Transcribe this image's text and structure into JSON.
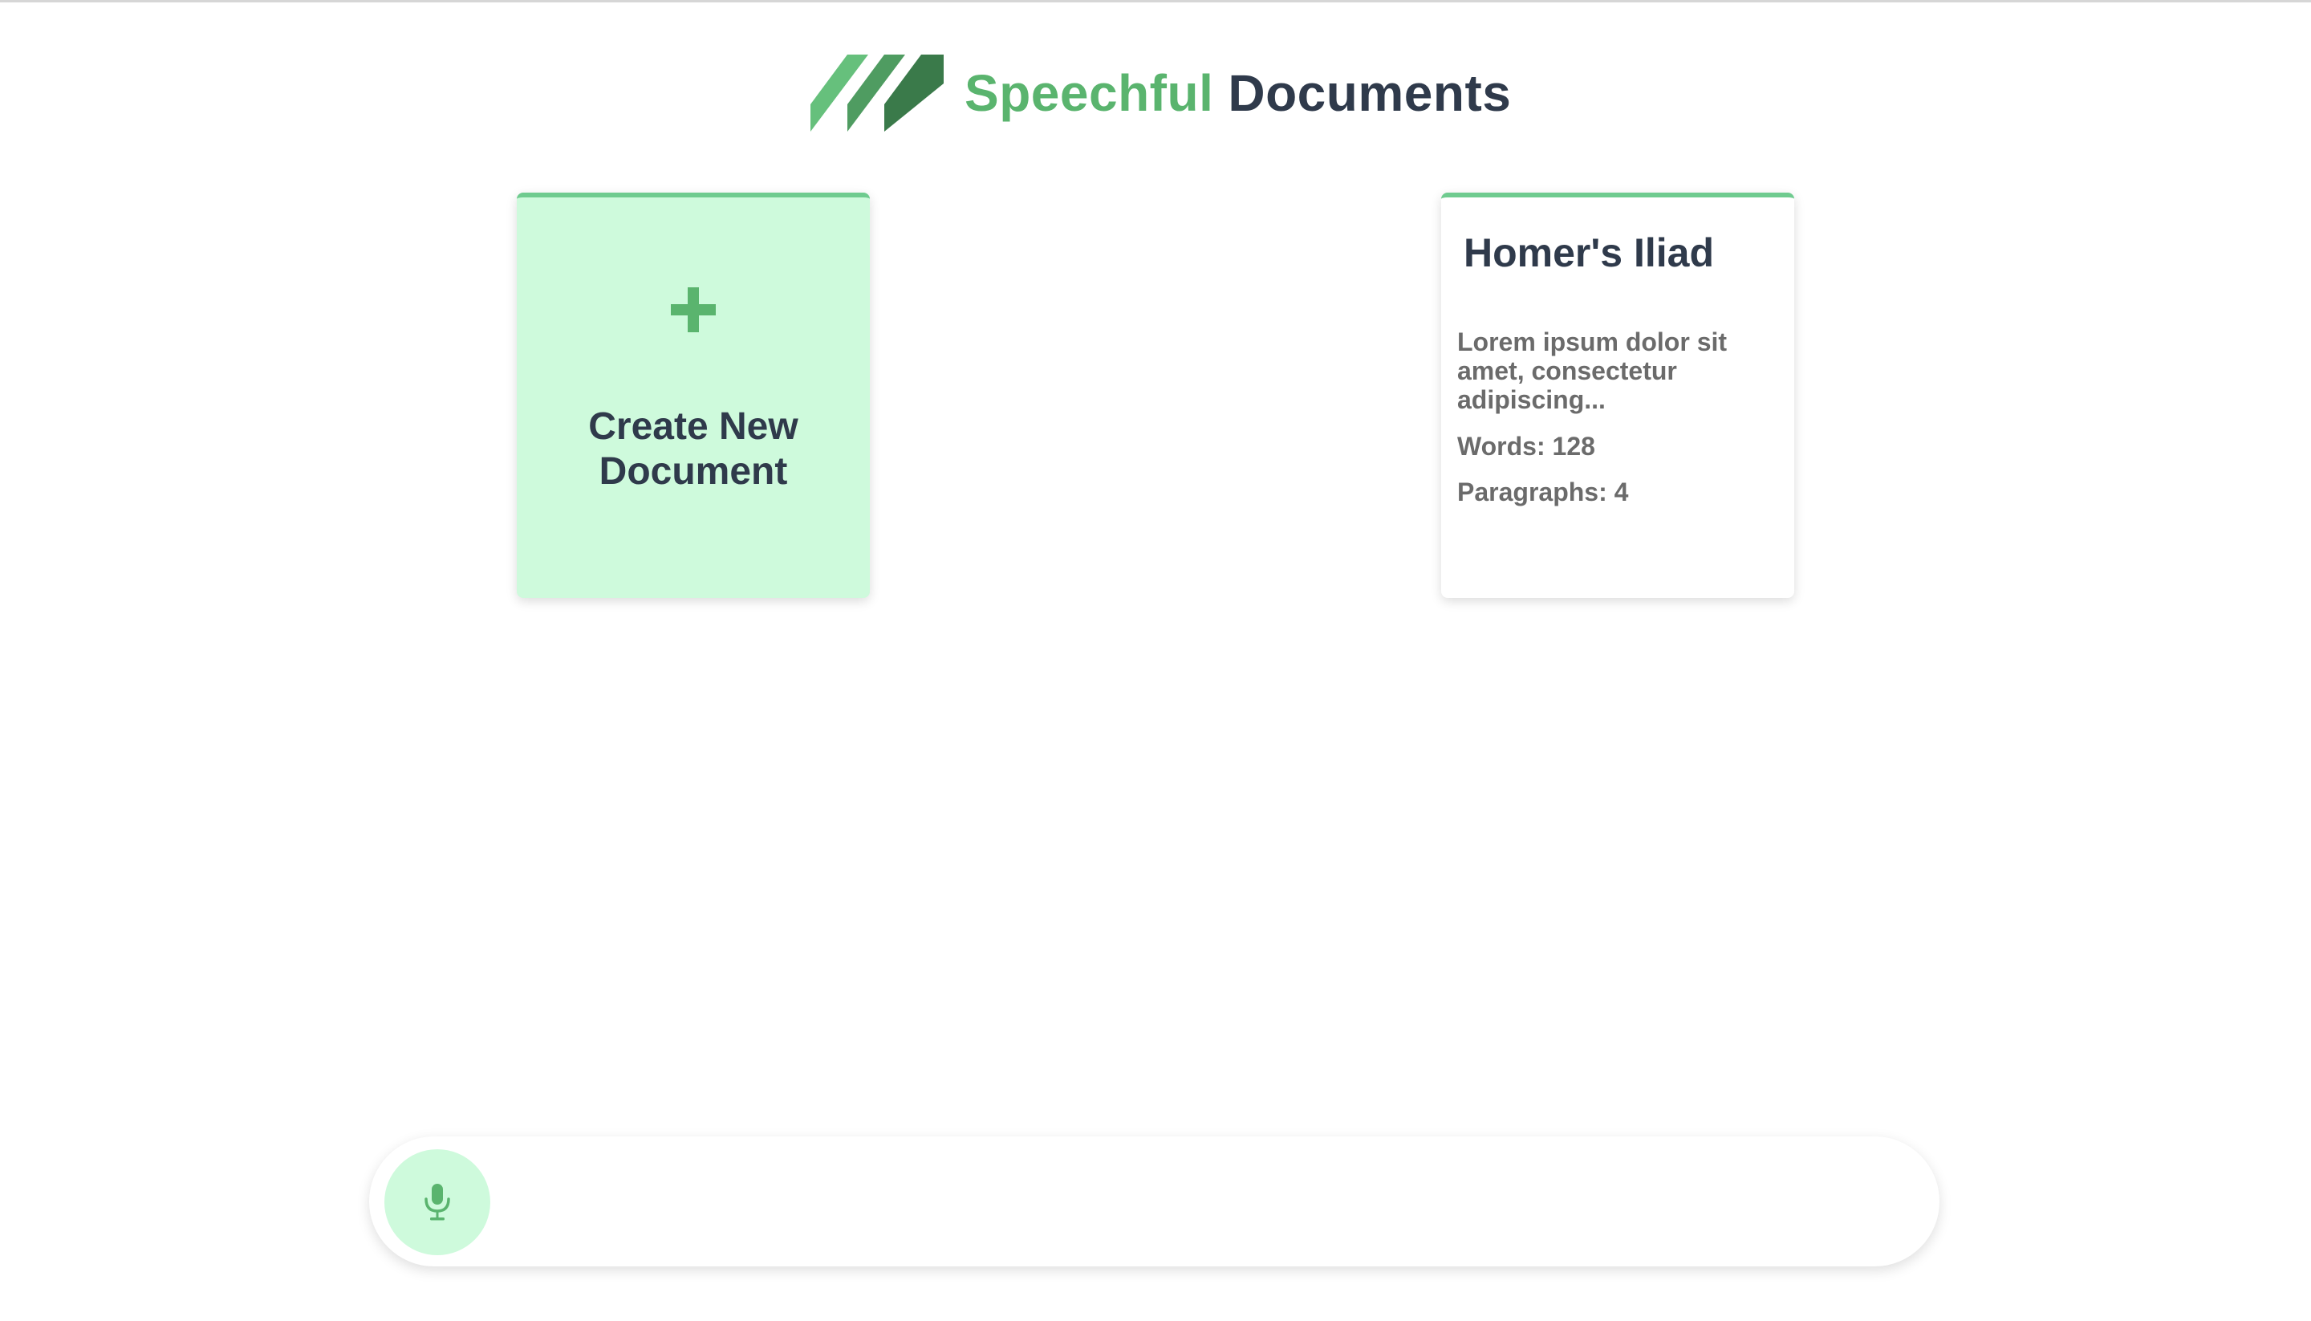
{
  "header": {
    "brand_primary": "Speechful",
    "brand_secondary": "Documents"
  },
  "create_card": {
    "icon": "plus-icon",
    "label": "Create New Document"
  },
  "documents": [
    {
      "title": "Homer's Iliad",
      "excerpt": "Lorem ipsum dolor sit amet, consectetur adipiscing...",
      "words": "Words: 128",
      "paragraphs": "Paragraphs: 4"
    }
  ],
  "voice_input": {
    "icon": "microphone-icon",
    "value": ""
  },
  "colors": {
    "accent": "#5ab46e",
    "accent_light": "#cefadc",
    "text_dark": "#2f3a4b",
    "text_muted": "#6b6b6b",
    "card_border": "#6fcb8f"
  }
}
